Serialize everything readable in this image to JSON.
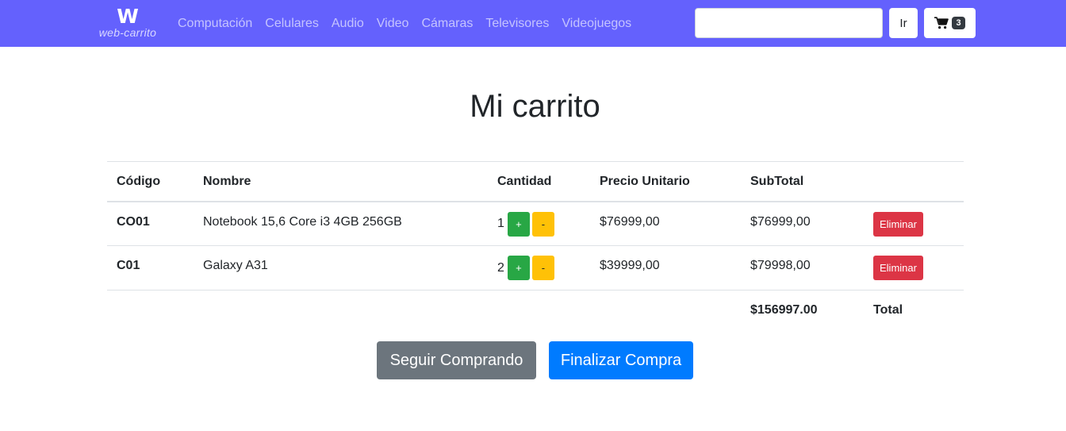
{
  "navbar": {
    "brand_mark": "W",
    "brand_text": "web-carrito",
    "links": [
      "Computación",
      "Celulares",
      "Audio",
      "Video",
      "Cámaras",
      "Televisores",
      "Videojuegos"
    ],
    "search_placeholder": "",
    "search_value": "",
    "go_label": "Ir",
    "cart_icon": "shopping-cart-icon",
    "cart_count": "3",
    "bg_color": "#6461fd"
  },
  "page": {
    "title": "Mi carrito"
  },
  "table": {
    "headers": {
      "code": "Código",
      "name": "Nombre",
      "quantity": "Cantidad",
      "unit_price": "Precio Unitario",
      "subtotal": "SubTotal"
    },
    "rows": [
      {
        "code": "CO01",
        "name": "Notebook 15,6 Core i3 4GB 256GB",
        "quantity": "1",
        "unit_price": "$76999,00",
        "subtotal": "$76999,00",
        "plus_label": "+",
        "minus_label": "-",
        "delete_label": "Eliminar"
      },
      {
        "code": "C01",
        "name": "Galaxy A31",
        "quantity": "2",
        "unit_price": "$39999,00",
        "subtotal": "$79998,00",
        "plus_label": "+",
        "minus_label": "-",
        "delete_label": "Eliminar"
      }
    ],
    "total_value": "$156997.00",
    "total_label": "Total"
  },
  "actions": {
    "continue_label": "Seguir Comprando",
    "checkout_label": "Finalizar Compra"
  },
  "colors": {
    "success": "#28a745",
    "warning": "#ffc107",
    "danger": "#dc3545",
    "secondary": "#6c757d",
    "primary": "#007bff"
  }
}
